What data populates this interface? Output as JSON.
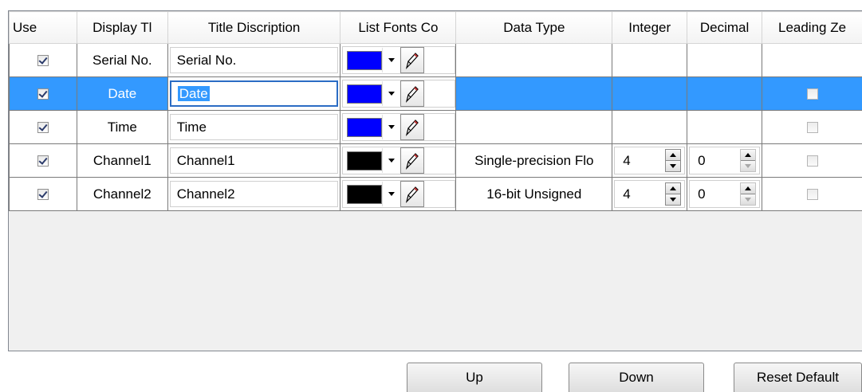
{
  "columns": [
    "Use",
    "Display Tl",
    "Title Discription",
    "List Fonts Co",
    "Data Type",
    "Integer",
    "Decimal",
    "Leading Zе"
  ],
  "rows": [
    {
      "use": true,
      "display": "Serial No.",
      "title": "Serial No.",
      "color": "#0000ff",
      "data_type": "",
      "integer": "",
      "decimal": "",
      "leading_zero": null,
      "selected": false
    },
    {
      "use": true,
      "display": "Date",
      "title": "Date",
      "color": "#0000ff",
      "data_type": "",
      "integer": "",
      "decimal": "",
      "leading_zero": false,
      "selected": true
    },
    {
      "use": true,
      "display": "Time",
      "title": "Time",
      "color": "#0000ff",
      "data_type": "",
      "integer": "",
      "decimal": "",
      "leading_zero": false,
      "selected": false
    },
    {
      "use": true,
      "display": "Channel1",
      "title": "Channel1",
      "color": "#000000",
      "data_type": "Single-precision Flo",
      "integer": "4",
      "decimal": "0",
      "leading_zero": false,
      "selected": false
    },
    {
      "use": true,
      "display": "Channel2",
      "title": "Channel2",
      "color": "#000000",
      "data_type": "16-bit Unsigned",
      "integer": "4",
      "decimal": "0",
      "leading_zero": false,
      "selected": false
    }
  ],
  "buttons": {
    "up": "Up",
    "down": "Down",
    "reset": "Reset Default"
  },
  "colors": {
    "selection": "#3399ff",
    "grid_line": "#7a7a7a"
  }
}
